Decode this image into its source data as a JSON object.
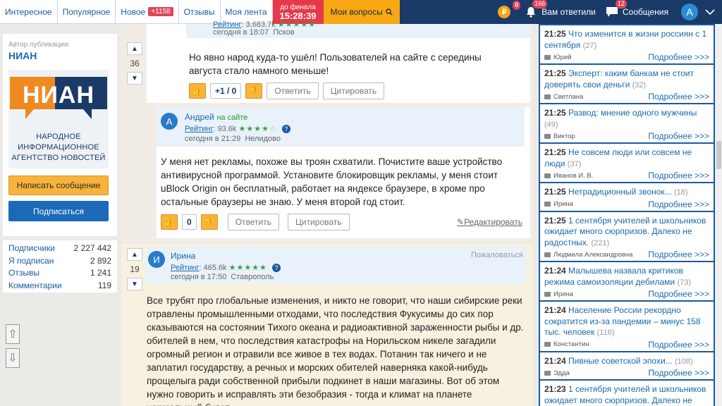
{
  "nav": {
    "tabs": [
      {
        "label": "Интересное"
      },
      {
        "label": "Популярное"
      },
      {
        "label": "Новое",
        "count": "+1158"
      },
      {
        "label": "Отзывы"
      },
      {
        "label": "Моя лента"
      }
    ],
    "deadline_label": "до финала",
    "deadline_time": "15:28:39",
    "my_questions": "Мои вопросы",
    "coin_letter": "₽",
    "coin_badge": "0",
    "answers_badge": "166",
    "answers_label": "Вам ответили",
    "messages_badge": "12",
    "messages_label": "Сообщения",
    "avatar_letter": "А"
  },
  "author": {
    "label": "Автор публикации:",
    "name": "НИАН",
    "logo_big": "НИАН",
    "logo_sub": "НАРОДНОЕ ИНФОРМАЦИОННОЕ АГЕНТСТВО НОВОСТЕЙ",
    "write_btn": "Написать сообщение",
    "subscribe_btn": "Подписаться"
  },
  "stats": [
    {
      "label": "Подписчики",
      "value": "2 227 442"
    },
    {
      "label": "Я подписан",
      "value": "2 892"
    },
    {
      "label": "Отзывы",
      "value": "1 241"
    },
    {
      "label": "Комментарии",
      "value": "119"
    }
  ],
  "comments": [
    {
      "votes": "36",
      "rating_label": "Рейтинг",
      "rating": "3,683.7k",
      "date": "сегодня в 18:07",
      "city": "Псков",
      "text": "Но явно народ куда-то ушёл! Пользователей на сайте с середины августа стало намного меньше!",
      "score": "+1 / 0",
      "reply": "Ответить",
      "quote": "Цитировать"
    },
    {
      "avatar": "А",
      "name": "Андрей",
      "status": "на сайте",
      "rating_label": "Рейтинг",
      "rating": "93.6k",
      "date": "сегодня в 21:29",
      "city": "Нелидово",
      "text": "У меня нет рекламы, похоже вы троян схватили. Почистите ваше устройство антивирусной программой. Установите блокировщик рекламы, у меня стоит uBlock Origin он бесплатный, работает на яндексе браузере, в хроме про остальные браузеры не знаю. У меня второй год стоит.",
      "score": "0",
      "reply": "Ответить",
      "quote": "Цитировать",
      "edit": "Редактировать"
    },
    {
      "votes": "19",
      "avatar": "И",
      "name": "Ирина",
      "complain": "Пожаловаться",
      "rating_label": "Рейтинг",
      "rating": "465.6k",
      "date": "сегодня в 17:50",
      "city": "Ставрополь",
      "text": "Все трубят про глобальные изменения, и никто не говорит, что наши сибирские реки отравлены промышленными отходами, что последствия Фукусимы до сих пор сказываются на состоянии Тихого океана и радиоактивной зараженности рыбы и др. обителей в нем, что последствия катастрофы на Норильском никеле загадили огромный регион и отравили все живое в тех водах. Потанин так ничего и не заплатил государству, а речных и морских обителей наверняка какой-нибудь прощелыга ради собственной прибыли подкинет в наши магазины. Вот об этом нужно говорить и исправлять эти безобразия - тогда и климат на планете нормальный будет."
    }
  ],
  "news_more": "Подробнее >>>",
  "news": [
    {
      "time": "21:25",
      "title": "Что изменится в жизни россиян с 1 сентября",
      "count": "(27)",
      "author": "Юрий"
    },
    {
      "time": "21:25",
      "title": "Эксперт: каким банкам не стоит доверять свои деньги",
      "count": "(32)",
      "author": "Светлана"
    },
    {
      "time": "21:25",
      "title": "Развод: мнение одного мужчины",
      "count": "(49)",
      "author": "Виктор"
    },
    {
      "time": "21:25",
      "title": "Не совсем люди или совсем не люди",
      "count": "(37)",
      "author": "Иванов И. В."
    },
    {
      "time": "21:25",
      "title": "Нетрадиционный звонок...",
      "count": "(18)",
      "author": "Ирина"
    },
    {
      "time": "21:25",
      "title": "1 сентября учителей и школьников ожидает много сюрпризов. Далеко не радостных.",
      "count": "(221)",
      "author": "Людмила Александровна"
    },
    {
      "time": "21:24",
      "title": "Малышева назвала критиков режима самоизоляции дебилами",
      "count": "(73)",
      "author": "Ирина"
    },
    {
      "time": "21:24",
      "title": "Население России рекордно сократится из-за пандемии – минус 158 тыс. человек",
      "count": "(116)",
      "author": "Константин"
    },
    {
      "time": "21:24",
      "title": "Пивные советской эпохи...",
      "count": "(108)",
      "author": "Эдда"
    },
    {
      "time": "21:23",
      "title": "1 сентября учителей и школьников ожидает много сюрпризов. Далеко не",
      "count": "",
      "author": ""
    }
  ]
}
